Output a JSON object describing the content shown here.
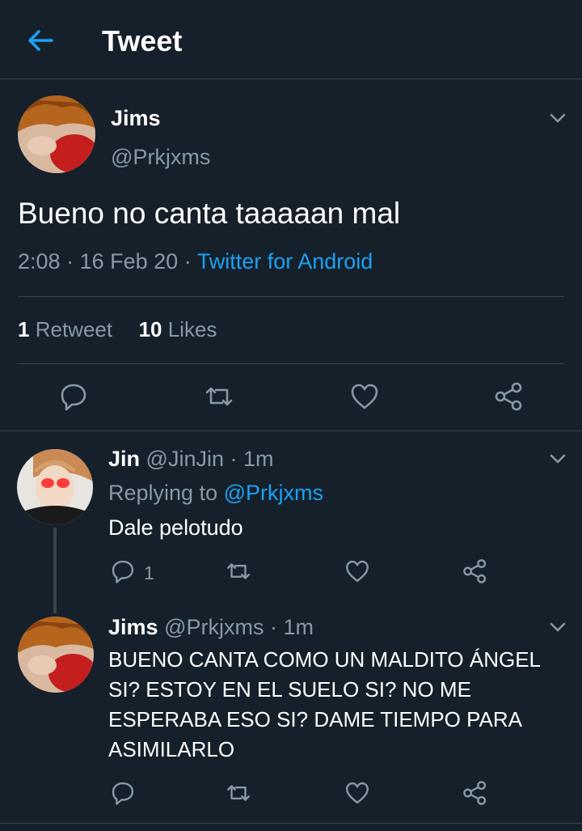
{
  "header": {
    "title": "Tweet",
    "back_icon": "arrow-left-icon",
    "accent": "#1da1f2"
  },
  "main_tweet": {
    "name": "Jims",
    "handle": "@Prkjxms",
    "text": "Bueno no canta taaaaan mal",
    "time": "2:08",
    "date": "16 Feb 20",
    "sep": "·",
    "source": "Twitter for Android",
    "retweet_count": "1",
    "retweet_label": "Retweet",
    "like_count": "10",
    "like_label": "Likes"
  },
  "replies": [
    {
      "name": "Jin",
      "handle": "@JinJin",
      "time": "· 1m",
      "replying_label": "Replying to",
      "replying_to": "@Prkjxms",
      "text": "Dale pelotudo",
      "reply_count": "1"
    },
    {
      "name": "Jims",
      "handle": "@Prkjxms",
      "time": "· 1m",
      "text": "BUENO CANTA COMO UN MALDITO ÁNGEL SI? ESTOY EN EL SUELO SI? NO ME ESPERABA ESO SI? DAME TIEMPO PARA ASIMILARLO"
    }
  ],
  "colors": {
    "background": "#15202b",
    "muted": "#8899a6",
    "divider": "#38444d"
  }
}
